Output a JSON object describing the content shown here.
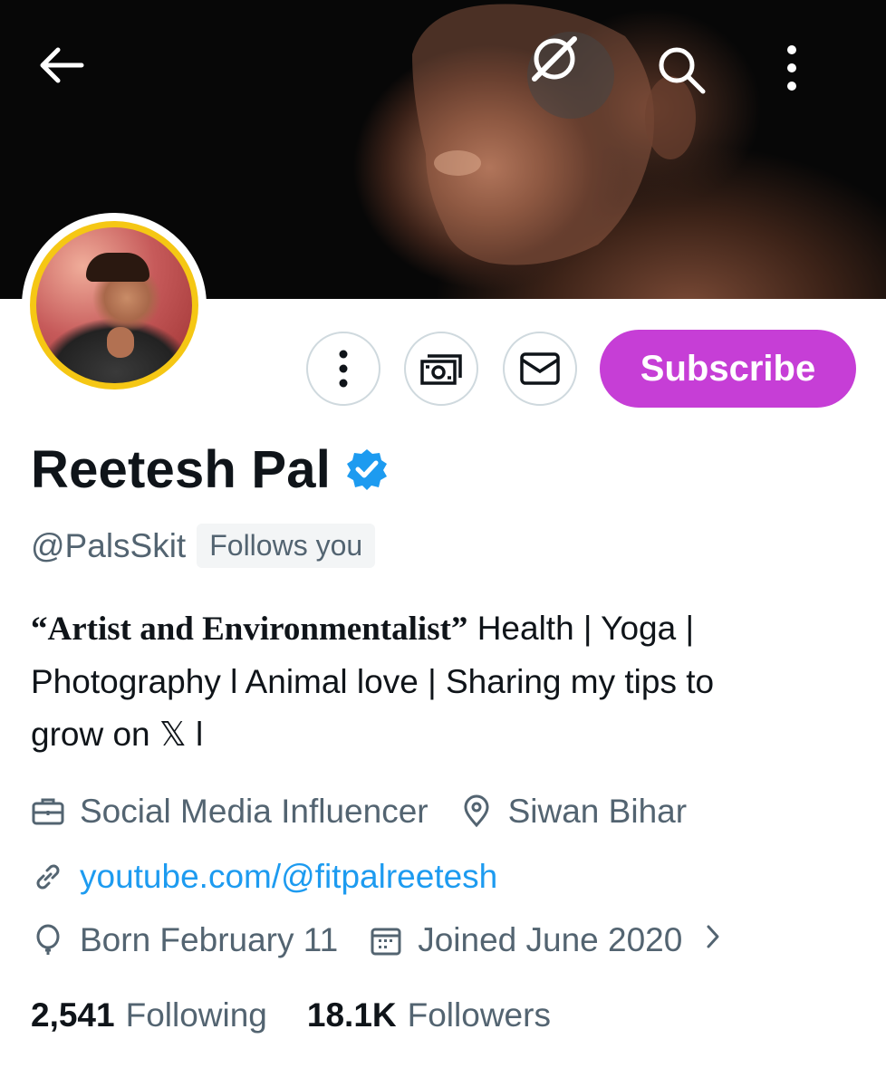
{
  "header": {
    "back_icon": "arrow-left-icon",
    "grok_icon": "grok-icon",
    "search_icon": "search-icon",
    "more_icon": "more-vertical-icon"
  },
  "profile": {
    "name": "Reetesh Pal",
    "handle": "@PalsSkit",
    "follows_you": "Follows you",
    "verified_color": "#1d9bf0",
    "avatar_ring_color": "#f5c714"
  },
  "actions": {
    "more_icon": "more-vertical-icon",
    "tip_icon": "money-icon",
    "message_icon": "mail-icon",
    "subscribe_label": "Subscribe",
    "subscribe_color": "#c63ed6"
  },
  "bio": {
    "quote": "“Artist and Environmentalist”",
    "line1_rest": " Health | Yoga |",
    "line2": "Photography l Animal love | Sharing my tips to",
    "line3": "grow on 𝕏 l"
  },
  "meta": {
    "profession": "Social Media Influencer",
    "location": "Siwan Bihar",
    "website": "youtube.com/@fitpalreetesh",
    "birthday": "Born February 11",
    "joined": "Joined June 2020"
  },
  "stats": {
    "following_count": "2,541",
    "following_label": "Following",
    "followers_count": "18.1K",
    "followers_label": "Followers"
  }
}
